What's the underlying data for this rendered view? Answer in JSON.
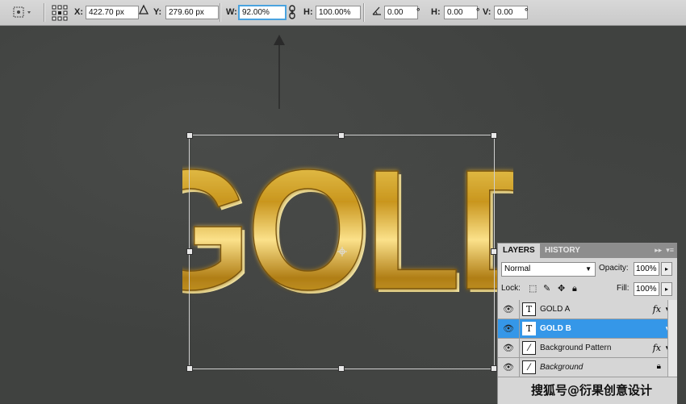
{
  "options_bar": {
    "x_label": "X:",
    "x_value": "422.70 px",
    "y_label": "Y:",
    "y_value": "279.60 px",
    "w_label": "W:",
    "w_value": "92.00%",
    "h_label": "H:",
    "h_value": "100.00%",
    "angle_value": "0.00",
    "skew_h_label": "H:",
    "skew_h_value": "0.00",
    "skew_v_label": "V:",
    "skew_v_value": "0.00",
    "degree_symbol": "°"
  },
  "canvas": {
    "text": "GOLD"
  },
  "layers_panel": {
    "tab_layers": "LAYERS",
    "tab_history": "HISTORY",
    "blend_mode": "Normal",
    "opacity_label": "Opacity:",
    "opacity_value": "100%",
    "lock_label": "Lock:",
    "fill_label": "Fill:",
    "fill_value": "100%",
    "layers": [
      {
        "name": "GOLD A",
        "type": "text",
        "fx": "fx",
        "selected": false
      },
      {
        "name": "GOLD B",
        "type": "text",
        "fx": "",
        "selected": true
      },
      {
        "name": "Background Pattern",
        "type": "brush",
        "fx": "fx",
        "selected": false
      },
      {
        "name": "Background",
        "type": "brush",
        "fx": "",
        "selected": false,
        "locked": true
      }
    ]
  },
  "watermark": "搜狐号@衍果创意设计",
  "colors": {
    "selection_blue": "#3597e8",
    "gold_light": "#f2d25a",
    "gold_dark": "#8a6512"
  }
}
